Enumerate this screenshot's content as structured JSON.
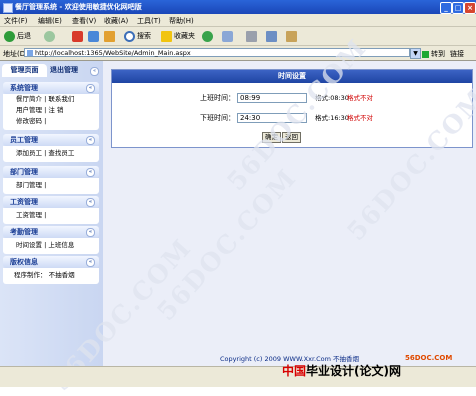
{
  "window": {
    "title": "餐厅管理系统 - 欢迎使用敏捷优化网吧版",
    "min": "_",
    "max": "□",
    "close": "×"
  },
  "menu": [
    "文件(F)",
    "编辑(E)",
    "查看(V)",
    "收藏(A)",
    "工具(T)",
    "帮助(H)"
  ],
  "toolbar": {
    "back": "后退",
    "search": "搜索",
    "favorites": "收藏夹"
  },
  "address": {
    "label": "地址(D)",
    "url": "http://localhost:1365/WebSite/Admin_Main.aspx",
    "go": "转到",
    "links": "链接"
  },
  "sidebar": {
    "tabs": [
      "管理页面",
      "退出管理"
    ],
    "sections": [
      {
        "title": "系统管理",
        "items": [
          "餐厅简介 | 联系我们",
          "用户管理 | 注 销",
          "修改密码 |"
        ]
      },
      {
        "title": "员工管理",
        "items": [
          "添加员工 | 查找员工"
        ]
      },
      {
        "title": "部门管理",
        "items": [
          "部门管理 |"
        ]
      },
      {
        "title": "工资管理",
        "items": [
          "工资管理 |"
        ]
      },
      {
        "title": "考勤管理",
        "items": [
          "时间设置 | 上班信息"
        ]
      },
      {
        "title": "版权信息",
        "items": [
          "程序制作： 不抽香烟"
        ]
      }
    ]
  },
  "panel": {
    "title": "时间设置",
    "on": {
      "label": "上班时间：",
      "value": "08:99",
      "format": "格式:08:30",
      "error": "格式不对"
    },
    "off": {
      "label": "下班时间：",
      "value": "24:30",
      "format": "格式:16:30",
      "error": "格式不对"
    },
    "confirm": "确定",
    "back": "返回"
  },
  "footer": "Copyright (c) 2009 WWW.Xxr.Com 不抽香烟",
  "watermark": "56DOC.COM",
  "brand": {
    "site": "56DOC.COM",
    "text_a": "中国",
    "text_b": "毕业设计(论文)网"
  }
}
